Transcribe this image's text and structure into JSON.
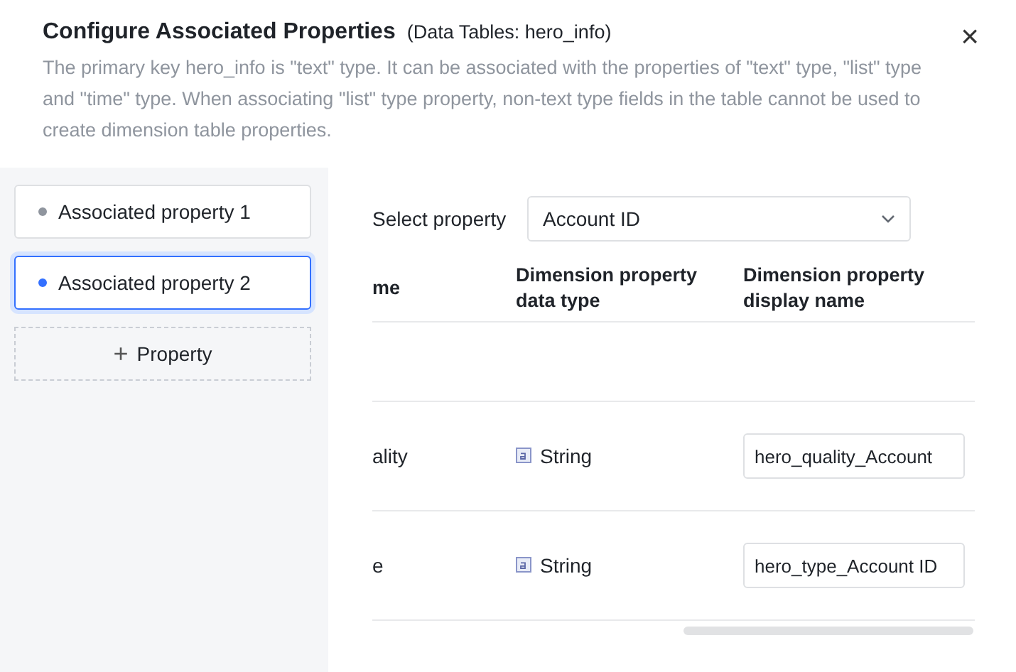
{
  "dialog": {
    "title": "Configure Associated Properties",
    "subtitle": "(Data Tables: hero_info)",
    "description": "The primary key hero_info is \"text\" type. It can be associated with the properties of \"text\" type, \"list\" type and \"time\" type. When associating \"list\" type property, non-text type fields in the table cannot be used to create dimension table properties.",
    "close": "×"
  },
  "sidebar": {
    "items": [
      {
        "label": "Associated property 1",
        "selected": false
      },
      {
        "label": "Associated property 2",
        "selected": true
      }
    ],
    "add_button": {
      "icon": "+",
      "label": "Property"
    }
  },
  "select_property": {
    "label": "Select property",
    "value": "Account ID"
  },
  "table": {
    "columns": [
      "me",
      "Dimension property data type",
      "Dimension property display name"
    ],
    "rows": [
      {
        "column_1": "",
        "data_type": "",
        "display_name": ""
      },
      {
        "column_1": "ality",
        "data_type": "String",
        "display_name": "hero_quality_Account"
      },
      {
        "column_1": "e",
        "data_type": "String",
        "display_name": "hero_type_Account ID"
      }
    ]
  }
}
